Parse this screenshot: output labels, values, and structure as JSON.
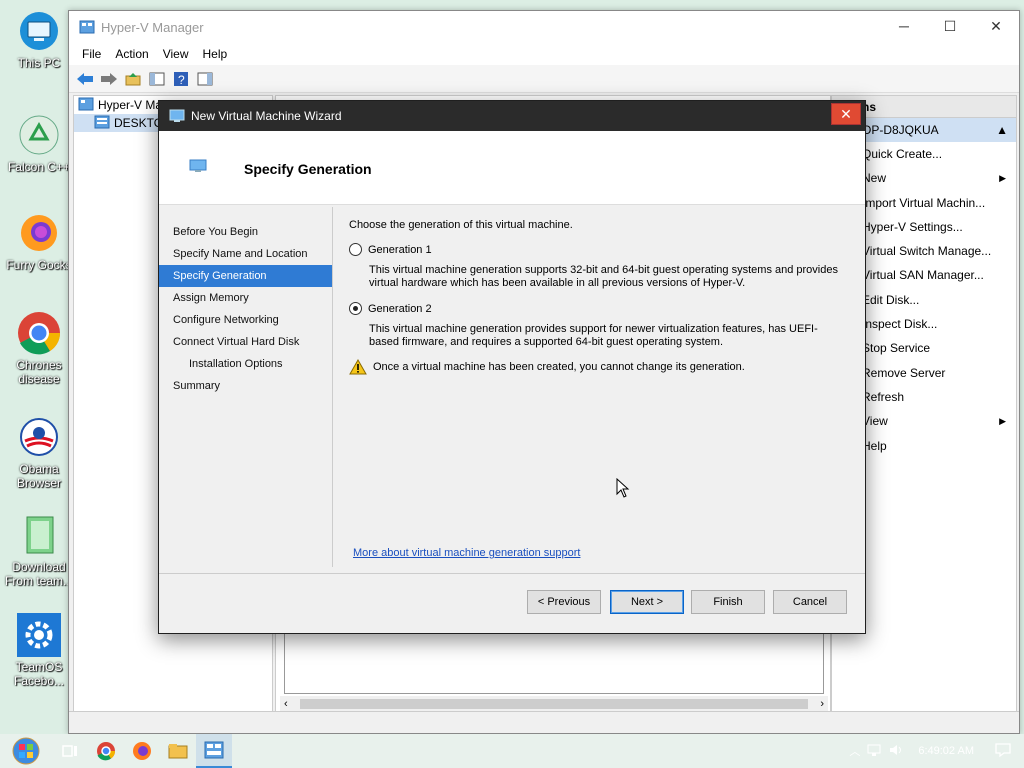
{
  "desktop": {
    "icons": [
      {
        "label": "This PC",
        "icon": "this-pc-icon"
      },
      {
        "label": "Falcon C++",
        "icon": "recycle-icon"
      },
      {
        "label": "Furry Gocks",
        "icon": "firefox-icon"
      },
      {
        "label": "Chrones disease",
        "icon": "chrome-icon"
      },
      {
        "label": "Obama Browser",
        "icon": "obama-icon"
      },
      {
        "label": "Download From team...",
        "icon": "notebook-icon"
      },
      {
        "label": "TeamOS Facebo...",
        "icon": "gear-icon"
      }
    ]
  },
  "hyperv": {
    "title": "Hyper-V Manager",
    "menu": [
      "File",
      "Action",
      "View",
      "Help"
    ],
    "tree": {
      "root": "Hyper-V Ma",
      "child": "DESKTO"
    },
    "actions": {
      "header": "ns",
      "server": "OP-D8JQKUA",
      "items": [
        {
          "label": "Quick Create...",
          "arrow": ""
        },
        {
          "label": "New",
          "arrow": "▶"
        },
        {
          "label": "Import Virtual Machin...",
          "arrow": ""
        },
        {
          "label": "Hyper-V Settings...",
          "arrow": ""
        },
        {
          "label": "Virtual Switch Manage...",
          "arrow": ""
        },
        {
          "label": "Virtual SAN Manager...",
          "arrow": ""
        },
        {
          "label": "Edit Disk...",
          "arrow": ""
        },
        {
          "label": "Inspect Disk...",
          "arrow": ""
        },
        {
          "label": "Stop Service",
          "arrow": ""
        },
        {
          "label": "Remove Server",
          "arrow": ""
        },
        {
          "label": "Refresh",
          "arrow": ""
        },
        {
          "label": "View",
          "arrow": "▶"
        },
        {
          "label": "Help",
          "arrow": ""
        }
      ]
    }
  },
  "wizard": {
    "title": "New Virtual Machine Wizard",
    "heading": "Specify Generation",
    "nav": [
      {
        "label": "Before You Begin",
        "active": false,
        "indent": false
      },
      {
        "label": "Specify Name and Location",
        "active": false,
        "indent": false
      },
      {
        "label": "Specify Generation",
        "active": true,
        "indent": false
      },
      {
        "label": "Assign Memory",
        "active": false,
        "indent": false
      },
      {
        "label": "Configure Networking",
        "active": false,
        "indent": false
      },
      {
        "label": "Connect Virtual Hard Disk",
        "active": false,
        "indent": false
      },
      {
        "label": "Installation Options",
        "active": false,
        "indent": true
      },
      {
        "label": "Summary",
        "active": false,
        "indent": false
      }
    ],
    "intro": "Choose the generation of this virtual machine.",
    "gen1": {
      "label": "Generation 1",
      "selected": false,
      "desc": "This virtual machine generation supports 32-bit and 64-bit guest operating systems and provides virtual hardware which has been available in all previous versions of Hyper-V."
    },
    "gen2": {
      "label": "Generation 2",
      "selected": true,
      "desc": "This virtual machine generation provides support for newer virtualization features, has UEFI-based firmware, and requires a supported 64-bit guest operating system."
    },
    "warning": "Once a virtual machine has been created, you cannot change its generation.",
    "link": "More about virtual machine generation support",
    "buttons": {
      "previous": "< Previous",
      "next": "Next >",
      "finish": "Finish",
      "cancel": "Cancel"
    }
  },
  "taskbar": {
    "clock": "6:49:02 AM"
  }
}
